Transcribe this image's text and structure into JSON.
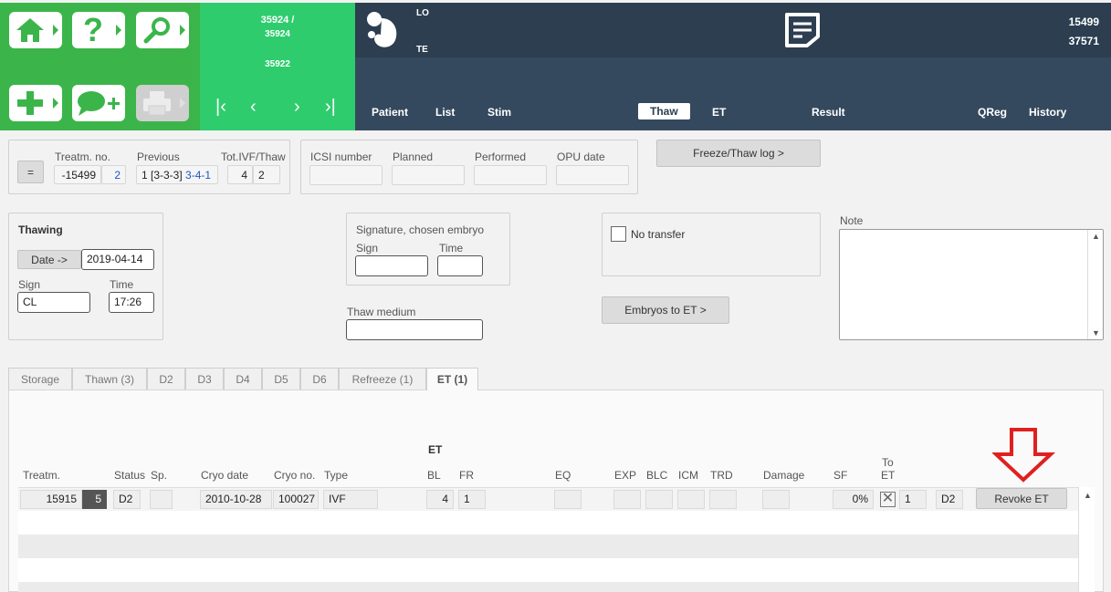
{
  "header": {
    "record_top": "35924 /",
    "record_sub": "35924",
    "record_bottom": "35922",
    "patient_line1": "LO",
    "patient_line2": "TE",
    "id1": "15499",
    "id2": "37571",
    "tabs": [
      "Patient",
      "List",
      "Stim",
      "Thaw",
      "ET",
      "Result",
      "QReg",
      "History"
    ],
    "active_tab": "Thaw",
    "icons": [
      "home-icon",
      "help-icon",
      "search-icon",
      "add-icon",
      "comment-add-icon",
      "printer-icon",
      "first-icon",
      "prev-icon",
      "next-icon",
      "last-icon",
      "baby-icon",
      "note-icon"
    ]
  },
  "treatment": {
    "eq_label": "=",
    "treatm_label": "Treatm. no.",
    "treatm_value": "-15499",
    "treatm_count": "2",
    "previous_label": "Previous",
    "previous_value": "1 [3-3-3]",
    "previous_value_blue": "3-4-1",
    "tot_label": "Tot.IVF/Thaw",
    "tot_ivf": "4",
    "tot_thaw": "2"
  },
  "icsi": {
    "icsi_label": "ICSI number",
    "planned_label": "Planned",
    "performed_label": "Performed",
    "opu_label": "OPU date"
  },
  "freeze_log_button": "Freeze/Thaw log >",
  "thawing": {
    "title": "Thawing",
    "date_button": "Date ->",
    "date_value": "2019-04-14",
    "sign_label": "Sign",
    "sign_value": "CL",
    "time_label": "Time",
    "time_value": "17:26"
  },
  "signature": {
    "title": "Signature, chosen embryo",
    "sign_label": "Sign",
    "time_label": "Time"
  },
  "thaw_medium_label": "Thaw medium",
  "no_transfer_label": "No transfer",
  "embryos_to_et_button": "Embryos to ET >",
  "note_label": "Note",
  "subtabs": [
    "Storage",
    "Thawn (3)",
    "D2",
    "D3",
    "D4",
    "D5",
    "D6",
    "Refreeze (1)",
    "ET (1)"
  ],
  "table": {
    "group_label": "ET",
    "columns": {
      "treatm": "Treatm.",
      "status": "Status",
      "sp": "Sp.",
      "cryo_date": "Cryo date",
      "cryo_no": "Cryo no.",
      "type": "Type",
      "bl": "BL",
      "fr": "FR",
      "eq": "EQ",
      "exp": "EXP",
      "blc": "BLC",
      "icm": "ICM",
      "trd": "TRD",
      "damage": "Damage",
      "sf": "SF",
      "to_et_1": "To",
      "to_et_2": "ET"
    },
    "rows": [
      {
        "treatm": "15915",
        "num": "5",
        "status": "D2",
        "sp": "",
        "cryo_date": "2010-10-28",
        "cryo_no": "100027",
        "type": "IVF",
        "bl": "4",
        "fr": "1",
        "eq": "",
        "exp": "",
        "blc": "",
        "icm": "",
        "trd": "",
        "damage": "",
        "sf": "0%",
        "to_et_checked": true,
        "to_et_count": "1",
        "day": "D2",
        "action": "Revoke ET"
      }
    ]
  },
  "colors": {
    "green_left": "#3bb54a",
    "green_right": "#2fcc6e",
    "dark_header": "#2c3e50",
    "accent_blue": "#1e56c8",
    "annotation_arrow": "#e02020"
  }
}
